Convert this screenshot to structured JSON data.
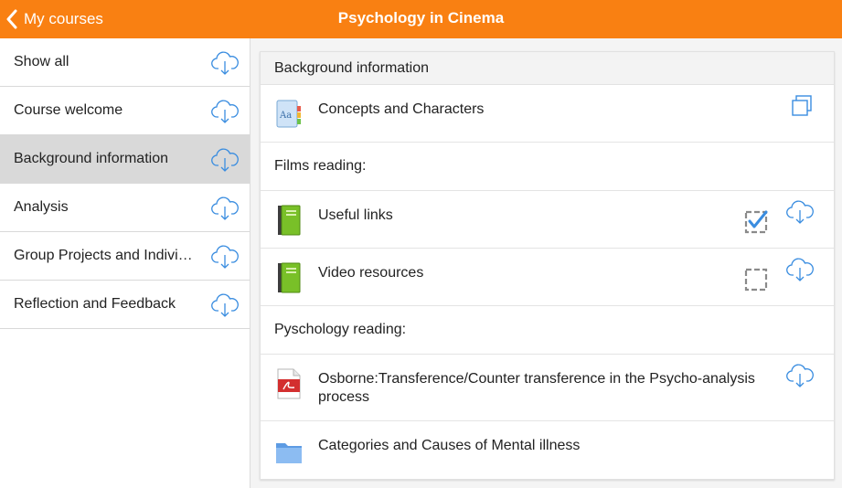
{
  "header": {
    "back_label": "My courses",
    "title": "Psychology in Cinema"
  },
  "sidebar": {
    "items": [
      {
        "label": "Show all",
        "icon": "cloud-download-icon"
      },
      {
        "label": "Course welcome",
        "icon": "cloud-download-icon"
      },
      {
        "label": "Background information",
        "icon": "cloud-download-icon",
        "selected": true
      },
      {
        "label": "Analysis",
        "icon": "cloud-download-icon"
      },
      {
        "label": "Group Projects and Indivi…",
        "icon": "cloud-download-icon"
      },
      {
        "label": "Reflection and Feedback",
        "icon": "cloud-download-icon"
      }
    ]
  },
  "section": {
    "title": "Background information",
    "rows": [
      {
        "kind": "module",
        "label": "Concepts and Characters",
        "icon": "glossary-icon",
        "action": "open-external-icon"
      },
      {
        "kind": "label",
        "label": "Films reading:"
      },
      {
        "kind": "module",
        "label": "Useful links",
        "icon": "book-icon",
        "completion": "checked",
        "action": "cloud-download-icon"
      },
      {
        "kind": "module",
        "label": "Video resources",
        "icon": "book-icon",
        "completion": "unchecked",
        "action": "cloud-download-icon"
      },
      {
        "kind": "label",
        "label": "Pyschology reading:"
      },
      {
        "kind": "module",
        "label": "Osborne:Transference/Counter transference in the Psycho-analysis process",
        "icon": "pdf-icon",
        "action": "cloud-download-icon"
      },
      {
        "kind": "module",
        "label": "Categories and Causes of Mental illness",
        "icon": "folder-icon"
      }
    ]
  },
  "colors": {
    "accent": "#f98012",
    "selected_bg": "#d9d9d9",
    "icon_blue": "#3a8de0"
  }
}
